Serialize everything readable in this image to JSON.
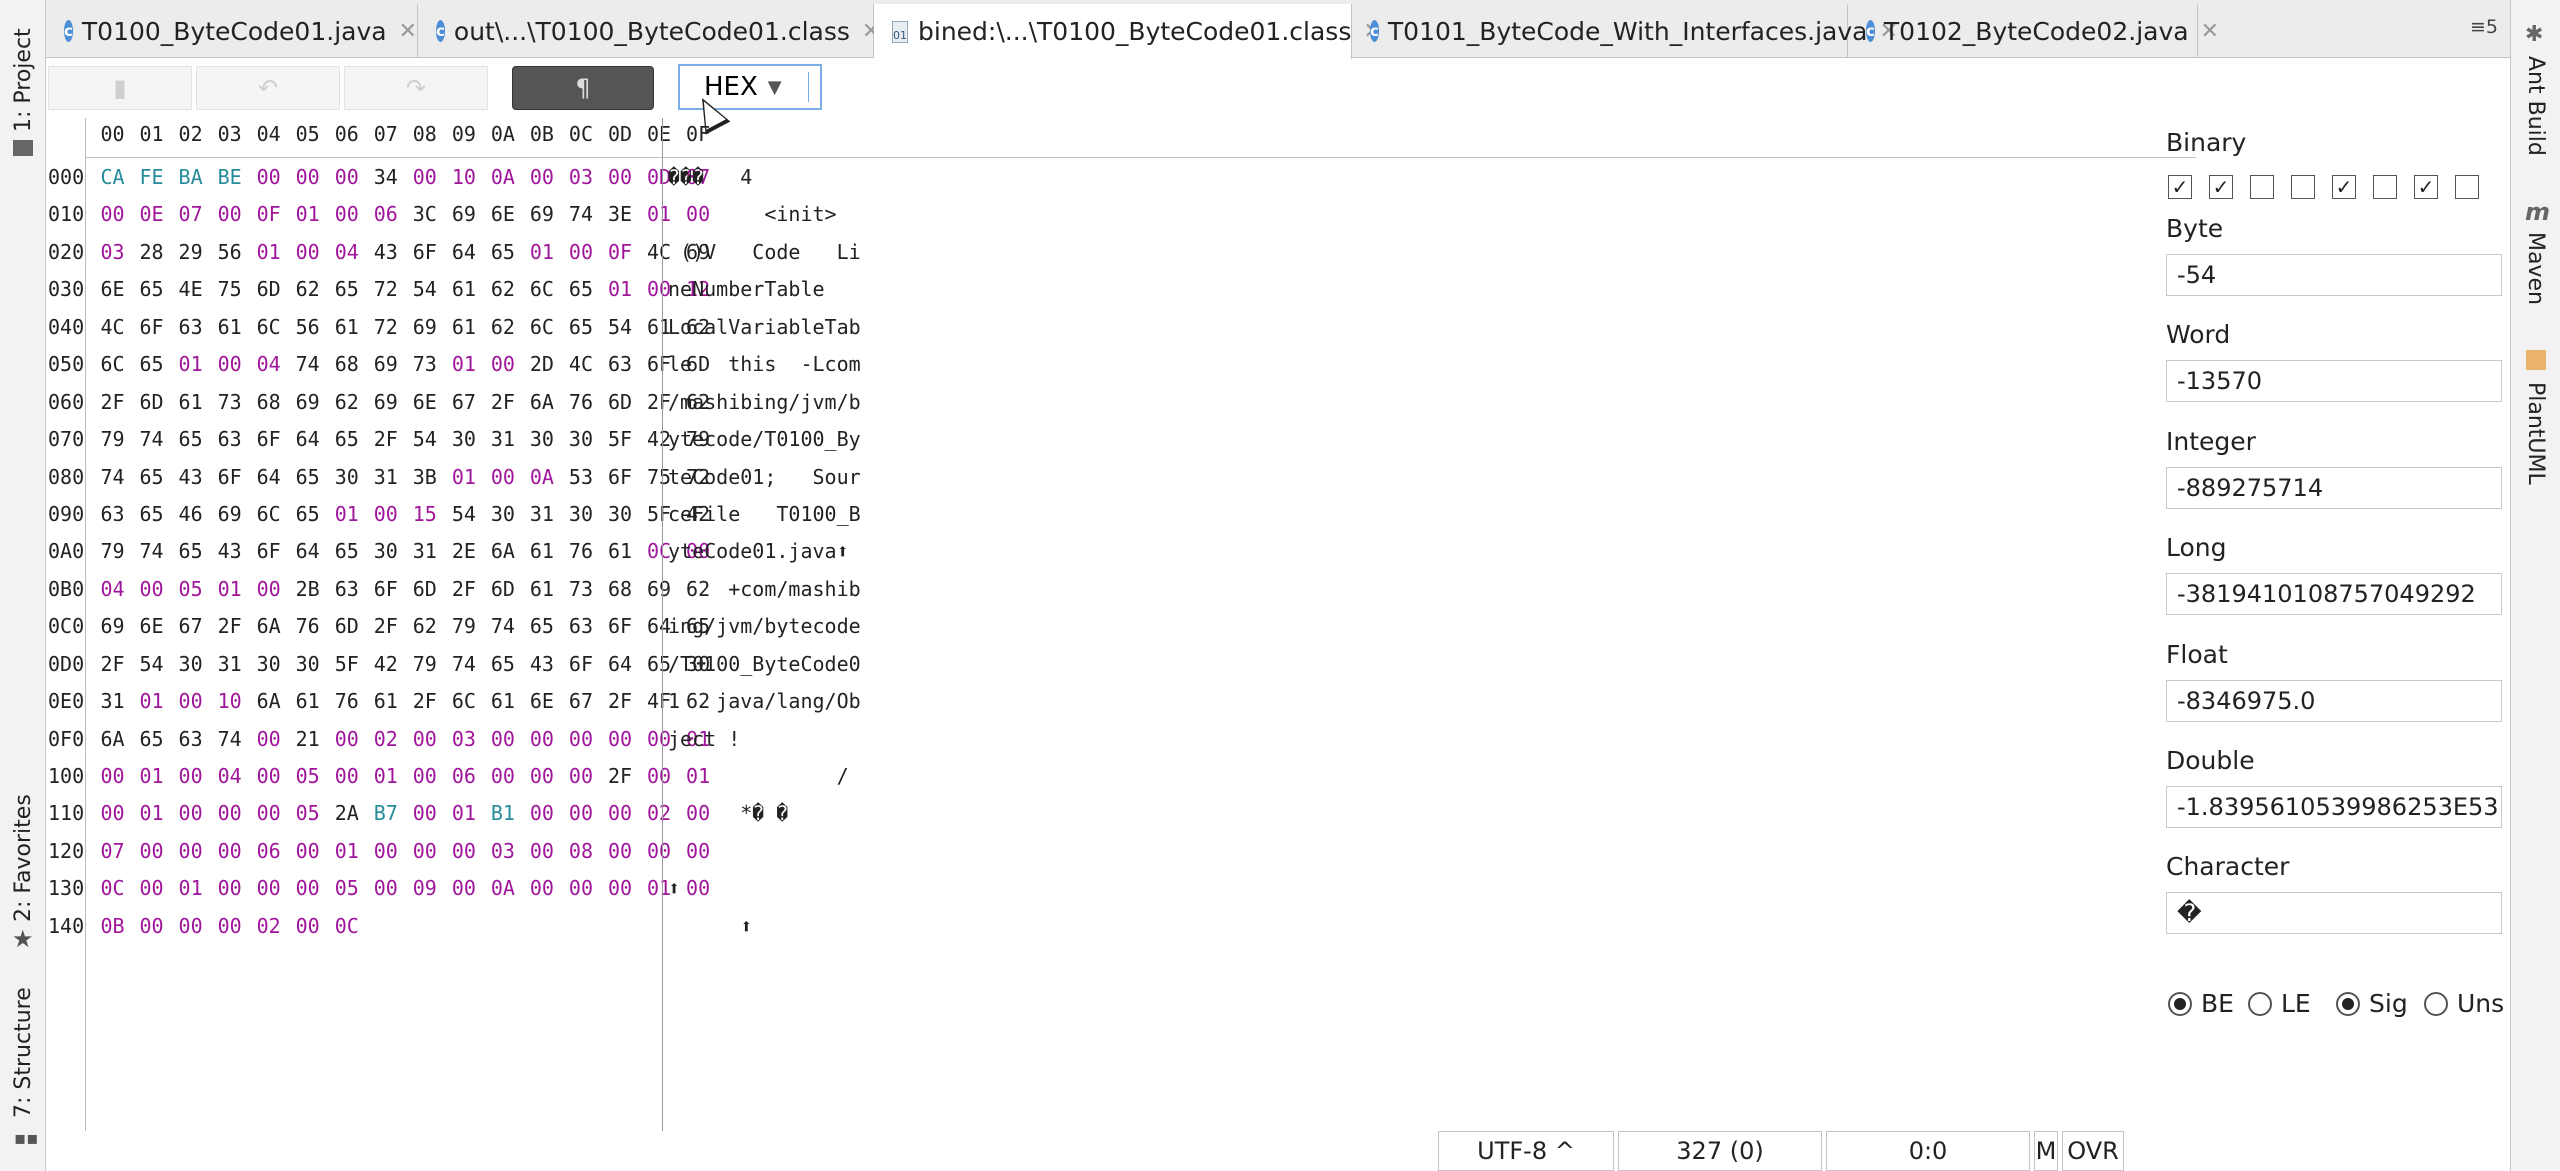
{
  "left_tools": [
    "1: Project",
    "2: Favorites",
    "7: Structure"
  ],
  "right_tools": [
    "Ant Build",
    "Maven",
    "PlantUML"
  ],
  "tabs": [
    {
      "label": "T0100_ByteCode01.java",
      "icon": "class-c-icon"
    },
    {
      "label": "out\\...\\T0100_ByteCode01.class",
      "icon": "class-c-icon"
    },
    {
      "label": "bined:\\...\\T0100_ByteCode01.class",
      "icon": "binary-file-icon"
    },
    {
      "label": "T0101_ByteCode_With_Interfaces.java",
      "icon": "class-c-icon"
    },
    {
      "label": "T0102_ByteCode02.java",
      "icon": "class-c-icon"
    }
  ],
  "tab_menu": "≡5",
  "toolbar": {
    "mode": "HEX",
    "para_icon": "¶"
  },
  "col_headers": [
    "00",
    "01",
    "02",
    "03",
    "04",
    "05",
    "06",
    "07",
    "08",
    "09",
    "0A",
    "0B",
    "0C",
    "0D",
    "0E",
    "0F"
  ],
  "rows": [
    {
      "off": "000",
      "bytes": "CA FE BA BE 00 00 00 34 00 10 0A 00 03 00 0D 07",
      "ascii": "���   4"
    },
    {
      "off": "010",
      "bytes": "00 0E 07 00 0F 01 00 06 3C 69 6E 69 74 3E 01 00",
      "ascii": "        <init>"
    },
    {
      "off": "020",
      "bytes": "03 28 29 56 01 00 04 43 6F 64 65 01 00 0F 4C 69",
      "ascii": " ()V   Code   Li"
    },
    {
      "off": "030",
      "bytes": "6E 65 4E 75 6D 62 65 72 54 61 62 6C 65 01 00 12",
      "ascii": "neNumberTable"
    },
    {
      "off": "040",
      "bytes": "4C 6F 63 61 6C 56 61 72 69 61 62 6C 65 54 61 62",
      "ascii": "LocalVariableTab"
    },
    {
      "off": "050",
      "bytes": "6C 65 01 00 04 74 68 69 73 01 00 2D 4C 63 6F 6D",
      "ascii": "le   this  -Lcom"
    },
    {
      "off": "060",
      "bytes": "2F 6D 61 73 68 69 62 69 6E 67 2F 6A 76 6D 2F 62",
      "ascii": "/mashibing/jvm/b"
    },
    {
      "off": "070",
      "bytes": "79 74 65 63 6F 64 65 2F 54 30 31 30 30 5F 42 79",
      "ascii": "ytecode/T0100_By"
    },
    {
      "off": "080",
      "bytes": "74 65 43 6F 64 65 30 31 3B 01 00 0A 53 6F 75 72",
      "ascii": "teCode01;   Sour"
    },
    {
      "off": "090",
      "bytes": "63 65 46 69 6C 65 01 00 15 54 30 31 30 30 5F 42",
      "ascii": "ceFile   T0100_B"
    },
    {
      "off": "0A0",
      "bytes": "79 74 65 43 6F 64 65 30 31 2E 6A 61 76 61 0C 00",
      "ascii": "yteCode01.java⬆"
    },
    {
      "off": "0B0",
      "bytes": "04 00 05 01 00 2B 63 6F 6D 2F 6D 61 73 68 69 62",
      "ascii": "     +com/mashib"
    },
    {
      "off": "0C0",
      "bytes": "69 6E 67 2F 6A 76 6D 2F 62 79 74 65 63 6F 64 65",
      "ascii": "ing/jvm/bytecode"
    },
    {
      "off": "0D0",
      "bytes": "2F 54 30 31 30 30 5F 42 79 74 65 43 6F 64 65 30",
      "ascii": "/T0100_ByteCode0"
    },
    {
      "off": "0E0",
      "bytes": "31 01 00 10 6A 61 76 61 2F 6C 61 6E 67 2F 4F 62",
      "ascii": "1   java/lang/Ob"
    },
    {
      "off": "0F0",
      "bytes": "6A 65 63 74 00 21 00 02 00 03 00 00 00 00 00 01",
      "ascii": "ject !"
    },
    {
      "off": "100",
      "bytes": "00 01 00 04 00 05 00 01 00 06 00 00 00 2F 00 01",
      "ascii": "              /"
    },
    {
      "off": "110",
      "bytes": "00 01 00 00 00 05 2A B7 00 01 B1 00 00 00 02 00",
      "ascii": "      *� �"
    },
    {
      "off": "120",
      "bytes": "07 00 00 00 06 00 01 00 00 00 03 00 08 00 00 00",
      "ascii": ""
    },
    {
      "off": "130",
      "bytes": "0C 00 01 00 00 00 05 00 09 00 0A 00 00 00 01 00",
      "ascii": "⬆"
    },
    {
      "off": "140",
      "bytes": "0B 00 00 00 02 00 0C",
      "ascii": "      ⬆"
    }
  ],
  "panel": {
    "binary_label": "Binary",
    "bits": [
      true,
      true,
      false,
      false,
      true,
      false,
      true,
      false
    ],
    "fields": [
      {
        "label": "Byte",
        "value": "-54"
      },
      {
        "label": "Word",
        "value": "-13570"
      },
      {
        "label": "Integer",
        "value": "-889275714"
      },
      {
        "label": "Long",
        "value": "-3819410108757049292"
      },
      {
        "label": "Float",
        "value": "-8346975.0"
      },
      {
        "label": "Double",
        "value": "-1.8395610539986253E53"
      },
      {
        "label": "Character",
        "value": "�"
      }
    ],
    "radios": [
      {
        "label": "BE",
        "checked": true
      },
      {
        "label": "LE",
        "checked": false
      },
      {
        "label": "Sig",
        "checked": true
      },
      {
        "label": "Uns",
        "checked": false
      }
    ]
  },
  "status": {
    "encoding": "UTF-8 ^",
    "size": "327 (0)",
    "position": "0:0",
    "mode_m": "M",
    "mode_ovr": "OVR"
  },
  "colors": {
    "teal": "#268b9a",
    "purple": "#a0169b",
    "dark": "#222222"
  }
}
